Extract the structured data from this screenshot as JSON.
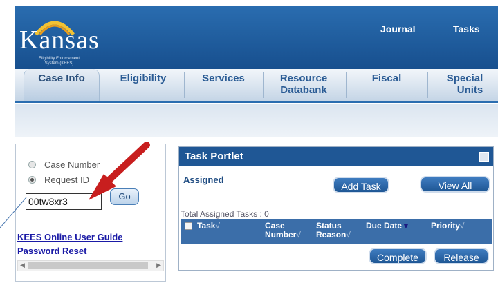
{
  "header": {
    "logo": {
      "title": "Kansas",
      "subtitle_line1": "Eligibility Enforcement",
      "subtitle_line2": "System (KEES)"
    },
    "links": [
      "Journal",
      "Tasks"
    ]
  },
  "tabs": [
    {
      "line1": "Case Info",
      "line2": ""
    },
    {
      "line1": "Eligibility",
      "line2": ""
    },
    {
      "line1": "Services",
      "line2": ""
    },
    {
      "line1": "Resource",
      "line2": "Databank"
    },
    {
      "line1": "Fiscal",
      "line2": ""
    },
    {
      "line1": "Special",
      "line2": "Units"
    }
  ],
  "search": {
    "options": [
      "Case Number",
      "Request ID"
    ],
    "selected": "Request ID",
    "value": "00tw8xr3",
    "go_label": "Go"
  },
  "left_links": [
    "KEES Online User Guide",
    "Password Reset"
  ],
  "portlet": {
    "title": "Task Portlet",
    "assigned_label": "Assigned",
    "add_task_label": "Add Task",
    "view_all_label": "View All",
    "total_label": "Total Assigned Tasks : 0",
    "columns": [
      {
        "line1": "Task",
        "line2": ""
      },
      {
        "line1": "Case",
        "line2": "Number"
      },
      {
        "line1": "Status",
        "line2": "Reason"
      },
      {
        "line1": "Due Date",
        "line2": ""
      },
      {
        "line1": "Priority",
        "line2": ""
      }
    ],
    "complete_label": "Complete",
    "release_label": "Release"
  },
  "colors": {
    "header_blue": "#1f5795",
    "arrow_red": "#c81e1e",
    "link_blue": "#1a1aa6"
  },
  "icons": [
    "logo-arc-icon",
    "settings-icon",
    "sort-down-icon",
    "red-arrow-icon",
    "scroll-left-icon",
    "scroll-right-icon"
  ]
}
